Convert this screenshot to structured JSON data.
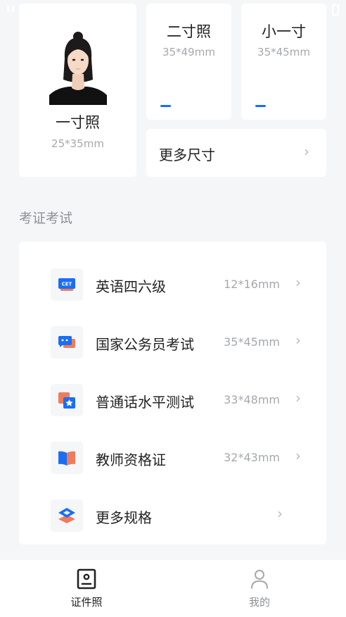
{
  "photo_sizes": {
    "one_inch": {
      "name": "一寸照",
      "dims": "25*35mm"
    },
    "two_inch": {
      "name": "二寸照",
      "dims": "35*49mm"
    },
    "small_one_inch": {
      "name": "小一寸",
      "dims": "35*45mm"
    },
    "more": {
      "label": "更多尺寸"
    }
  },
  "exam_section": {
    "title": "考证考试",
    "items": [
      {
        "label": "英语四六级",
        "dims": "12*16mm",
        "icon": "cet-icon",
        "icon_text": "CET"
      },
      {
        "label": "国家公务员考试",
        "dims": "35*45mm",
        "icon": "chat-icon"
      },
      {
        "label": "普通话水平测试",
        "dims": "33*48mm",
        "icon": "star-badge-icon"
      },
      {
        "label": "教师资格证",
        "dims": "32*43mm",
        "icon": "book-icon"
      },
      {
        "label": "更多规格",
        "dims": "",
        "icon": "layers-icon"
      }
    ]
  },
  "tabbar": {
    "tabs": [
      {
        "label": "证件照",
        "icon": "id-card-icon",
        "active": true
      },
      {
        "label": "我的",
        "icon": "user-icon",
        "active": false
      }
    ]
  },
  "colors": {
    "accent_blue": "#1a6ef5",
    "accent_orange": "#f07b5b",
    "background": "#f5f6f8",
    "active_tab": "#222222",
    "inactive_tab": "#8e9196"
  }
}
